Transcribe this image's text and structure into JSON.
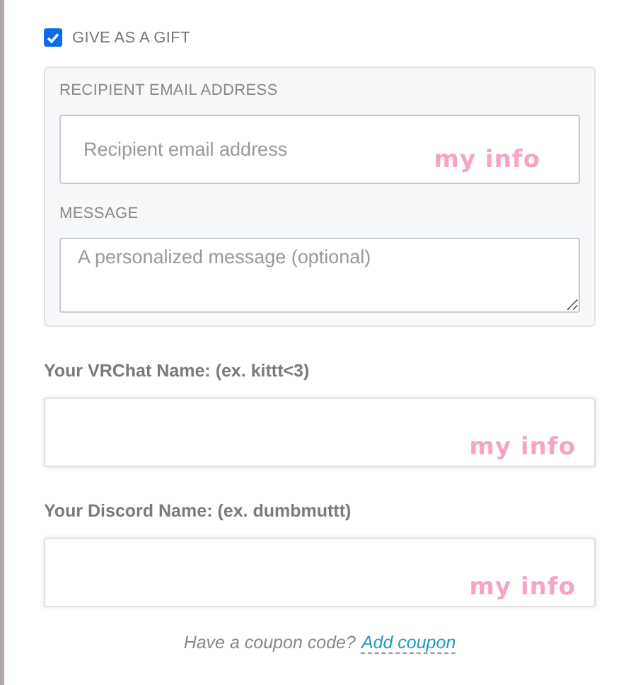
{
  "gift_checkbox": {
    "label": "GIVE AS A GIFT",
    "checked": true
  },
  "gift_panel": {
    "fields": [
      {
        "kind": "input",
        "label": "RECIPIENT EMAIL ADDRESS",
        "placeholder": "Recipient email address",
        "annotation": "my info"
      },
      {
        "kind": "textarea",
        "label": "MESSAGE",
        "placeholder": "A personalized message (optional)"
      }
    ]
  },
  "fields": [
    {
      "label": "Your VRChat Name: (ex. kittt<3)",
      "annotation": "my info"
    },
    {
      "label": "Your Discord Name: (ex. dumbmuttt)",
      "annotation": "my info"
    }
  ],
  "coupon": {
    "text": "Have a coupon code?",
    "link": "Add coupon"
  }
}
